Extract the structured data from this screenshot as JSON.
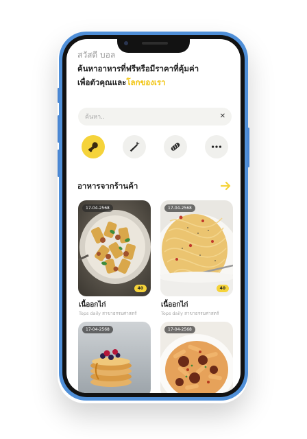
{
  "header": {
    "greeting": "สวัสดี บอล",
    "headline_line1": "ค้นหาอาหารที่ฟรีหรือมีราคาที่คุ้มค่า",
    "headline_line2_prefix": "เพื่อตัวคุณและ",
    "headline_line2_highlight": "โลกของเรา"
  },
  "search": {
    "placeholder": "ค้นหา..",
    "clear_glyph": "✕"
  },
  "categories": [
    {
      "icon": "chicken-leg-icon",
      "active": true
    },
    {
      "icon": "carrot-icon",
      "active": false
    },
    {
      "icon": "bread-icon",
      "active": false
    },
    {
      "icon": "more-icon",
      "active": false
    }
  ],
  "section": {
    "title": "อาหารจากร้านค้า",
    "arrow_glyph": "→"
  },
  "cards": [
    {
      "date": "17-04-2568",
      "count": "40",
      "title": "เนื้ออกไก่",
      "subtitle": "Tops daily สาขาธรรมศาสตร์",
      "image": "rigatoni-pasta"
    },
    {
      "date": "17-04-2568",
      "count": "40",
      "title": "เนื้ออกไก่",
      "subtitle": "Tops daily สาขาธรรมศาสตร์",
      "image": "spaghetti"
    },
    {
      "date": "17-04-2568",
      "image": "pancakes"
    },
    {
      "date": "17-04-2568",
      "image": "penne-meatballs"
    }
  ],
  "colors": {
    "accent": "#f5d33a",
    "highlight_text": "#f1c40f",
    "phone_frame": "#4f8fd8"
  }
}
